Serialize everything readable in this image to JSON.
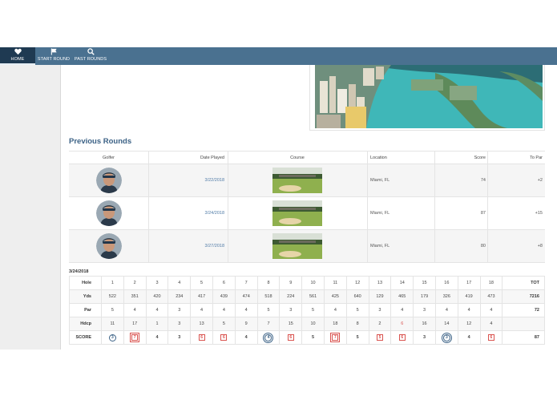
{
  "nav": {
    "home": {
      "label": "HOME",
      "icon": "heart-icon"
    },
    "start_round": {
      "label": "START ROUND",
      "icon": "flag-icon"
    },
    "past_rounds": {
      "label": "PAST ROUNDS",
      "icon": "search-icon"
    }
  },
  "colors": {
    "nav_bg": "#4a7190",
    "nav_active": "#1f3a52",
    "accent": "#3c6286",
    "over_par": "#d9534f"
  },
  "previous_rounds": {
    "title": "Previous Rounds",
    "columns": {
      "golfer": "Golfer",
      "date": "Date Played",
      "course": "Course",
      "location": "Location",
      "score": "Score",
      "to_par": "To Par"
    },
    "rows": [
      {
        "date": "3/22/2018",
        "location": "Miami, FL",
        "score": "74",
        "to_par": "+2"
      },
      {
        "date": "3/24/2018",
        "location": "Miami, FL",
        "score": "87",
        "to_par": "+15"
      },
      {
        "date": "3/27/2018",
        "location": "Miami, FL",
        "score": "80",
        "to_par": "+8"
      }
    ]
  },
  "scorecard": {
    "date": "3/24/2018",
    "labels": {
      "hole": "Hole",
      "yds": "Yds",
      "par": "Par",
      "hdcp": "Hdcp",
      "score": "SCORE"
    },
    "holes": [
      "1",
      "2",
      "3",
      "4",
      "5",
      "6",
      "7",
      "8",
      "9",
      "10",
      "11",
      "12",
      "13",
      "14",
      "15",
      "16",
      "17",
      "18",
      "TOT"
    ],
    "yards": [
      "522",
      "351",
      "420",
      "234",
      "417",
      "439",
      "474",
      "518",
      "224",
      "561",
      "425",
      "640",
      "129",
      "465",
      "179",
      "326",
      "419",
      "473",
      "7216"
    ],
    "par": [
      "5",
      "4",
      "4",
      "3",
      "4",
      "4",
      "4",
      "5",
      "3",
      "5",
      "4",
      "5",
      "3",
      "4",
      "3",
      "4",
      "4",
      "4",
      "72"
    ],
    "hdcp": [
      "11",
      "17",
      "1",
      "3",
      "13",
      "5",
      "9",
      "7",
      "15",
      "10",
      "18",
      "8",
      "2",
      "6",
      "16",
      "14",
      "12",
      "4",
      ""
    ],
    "score": [
      "3",
      "7",
      "4",
      "3",
      "6",
      "6",
      "4",
      "4",
      "6",
      "5",
      "7",
      "5",
      "5",
      "6",
      "3",
      "3",
      "4",
      "6",
      "87"
    ],
    "score_marks": [
      "circle",
      "dsquare",
      "",
      "",
      "square",
      "square",
      "",
      "dcircle",
      "square",
      "",
      "dsquare",
      "",
      "square",
      "square",
      "",
      "dcircle",
      "",
      "square",
      ""
    ],
    "hdcp_red": [
      false,
      false,
      false,
      false,
      false,
      false,
      false,
      false,
      false,
      false,
      false,
      false,
      false,
      true,
      false,
      false,
      false,
      false,
      false
    ]
  }
}
